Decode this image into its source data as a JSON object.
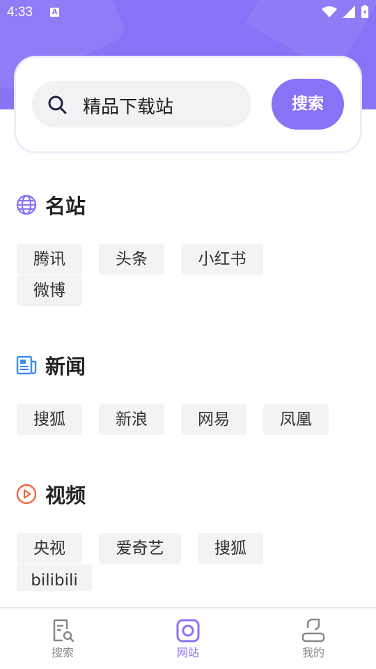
{
  "status_bar": {
    "time": "4:33",
    "notification_icon": "A"
  },
  "search": {
    "query": "精品下载站",
    "button_label": "搜索"
  },
  "sections": [
    {
      "title": "名站",
      "icon": "globe-icon",
      "icon_color": "#8673f5",
      "tags": [
        "腾讯",
        "头条",
        "小红书",
        "微博"
      ]
    },
    {
      "title": "新闻",
      "icon": "newspaper-icon",
      "icon_color": "#3d8bf2",
      "tags": [
        "搜狐",
        "新浪",
        "网易",
        "凤凰"
      ]
    },
    {
      "title": "视频",
      "icon": "play-icon",
      "icon_color": "#f0643c",
      "tags": [
        "央视",
        "爱奇艺",
        "搜狐",
        "bilibili"
      ]
    }
  ],
  "tab_bar": {
    "items": [
      {
        "label": "搜索",
        "icon": "search-document-icon",
        "active": false
      },
      {
        "label": "网站",
        "icon": "website-icon",
        "active": true
      },
      {
        "label": "我的",
        "icon": "user-icon",
        "active": false
      }
    ]
  },
  "colors": {
    "accent": "#8673f5",
    "tag_bg": "#f3f3f5",
    "inactive": "#888888"
  }
}
